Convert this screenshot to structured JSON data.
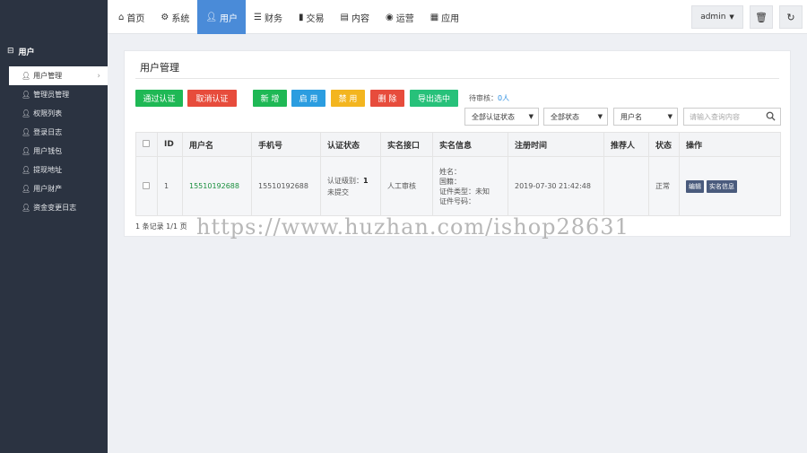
{
  "sidebar": {
    "group_title": "用户",
    "group_icon": "minus-square-icon",
    "items": [
      {
        "label": "用户管理",
        "icon": "user-icon",
        "active": true
      },
      {
        "label": "管理员管理",
        "icon": "user-icon"
      },
      {
        "label": "权限列表",
        "icon": "user-icon"
      },
      {
        "label": "登录日志",
        "icon": "user-icon"
      },
      {
        "label": "用户钱包",
        "icon": "user-icon"
      },
      {
        "label": "提现地址",
        "icon": "user-icon"
      },
      {
        "label": "用户财产",
        "icon": "user-icon"
      },
      {
        "label": "资金变更日志",
        "icon": "user-icon"
      }
    ]
  },
  "nav": {
    "items": [
      {
        "label": "首页",
        "icon": "home-icon"
      },
      {
        "label": "系统",
        "icon": "gear-icon"
      },
      {
        "label": "用户",
        "icon": "user-icon",
        "active": true
      },
      {
        "label": "财务",
        "icon": "list-icon"
      },
      {
        "label": "交易",
        "icon": "bar-chart-icon"
      },
      {
        "label": "内容",
        "icon": "document-icon"
      },
      {
        "label": "运营",
        "icon": "globe-icon"
      },
      {
        "label": "应用",
        "icon": "grid-icon"
      }
    ],
    "admin_label": "admin",
    "active_color": "#4a8bd8"
  },
  "panel": {
    "title": "用户管理",
    "buttons": {
      "approve": "通过认证",
      "cancel_cert": "取消认证",
      "add": "新 增",
      "enable": "启 用",
      "disable": "禁 用",
      "delete": "删 除",
      "export": "导出选中"
    },
    "pending_label": "待审核：",
    "pending_count": "0人",
    "filters": {
      "cert_status": "全部认证状态",
      "status": "全部状态",
      "field": "用户名",
      "search_placeholder": "请输入查询内容"
    }
  },
  "table": {
    "headers": [
      "ID",
      "用户名",
      "手机号",
      "认证状态",
      "实名接口",
      "实名信息",
      "注册时间",
      "推荐人",
      "状态",
      "操作"
    ],
    "rows": [
      {
        "id": "1",
        "username": "15510192688",
        "phone": "15510192688",
        "cert_level_label": "认证级别：",
        "cert_level": "1",
        "cert_status": "未提交",
        "api": "人工审核",
        "info": {
          "name": "姓名：",
          "nation": "国籍：",
          "doc_type": "证件类型：未知",
          "doc_no": "证件号码："
        },
        "reg_time": "2019-07-30 21:42:48",
        "referrer": "",
        "status": "正常",
        "ops": [
          "编辑",
          "实名信息"
        ]
      }
    ]
  },
  "pager": "1 条记录 1/1 页",
  "watermark": "https://www.huzhan.com/ishop28631"
}
